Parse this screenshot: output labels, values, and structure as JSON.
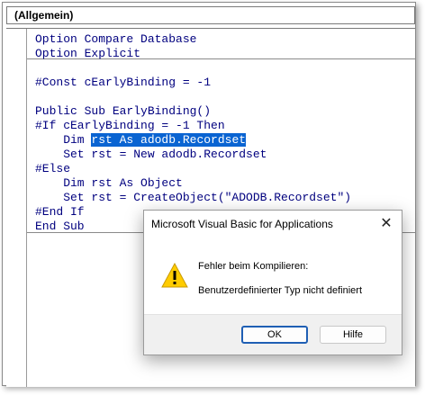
{
  "editor": {
    "procedure_combo": "(Allgemein)",
    "code_lines": [
      "Option Compare Database",
      "Option Explicit",
      "",
      "#Const cEarlyBinding = -1",
      "",
      "Public Sub EarlyBinding()",
      "#If cEarlyBinding = -1 Then",
      "    Dim ",
      "    Set rst = New adodb.Recordset",
      "#Else",
      "    Dim rst As Object",
      "    Set rst = CreateObject(\"ADODB.Recordset\")",
      "#End If",
      "End Sub"
    ],
    "selected_text": "rst As adodb.Recordset"
  },
  "dialog": {
    "title": "Microsoft Visual Basic for Applications",
    "heading": "Fehler beim Kompilieren:",
    "message": "Benutzerdefinierter Typ nicht definiert",
    "ok_label": "OK",
    "help_label": "Hilfe",
    "icon": "warning-icon"
  },
  "colors": {
    "selection": "#0a64d2",
    "code_text": "#00007f",
    "warning": "#ffcc00"
  }
}
